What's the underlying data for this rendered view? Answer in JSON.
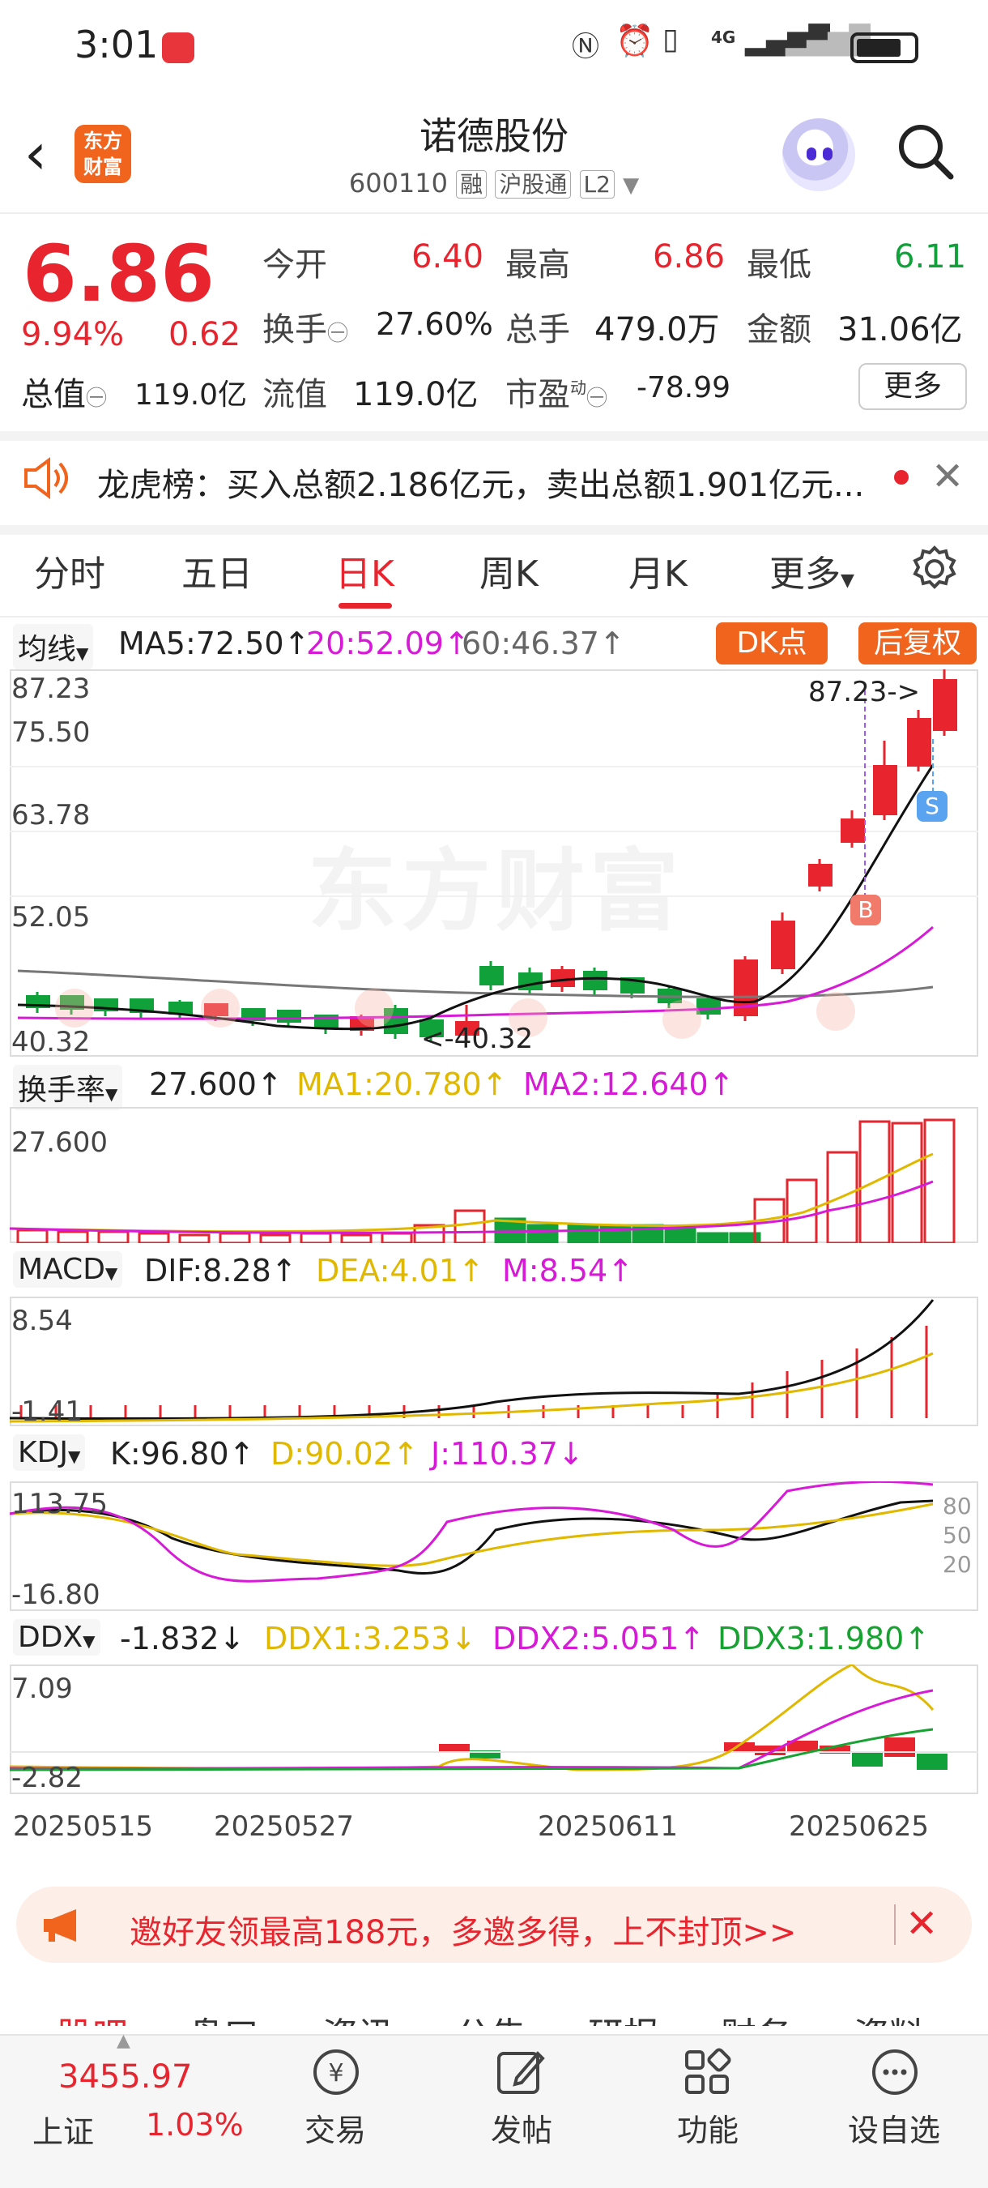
{
  "status_bar": {
    "time": "3:01",
    "network": "4G"
  },
  "header": {
    "logo_text": "东方财富",
    "stock_name": "诺德股份",
    "stock_code": "600110",
    "tags": [
      "融",
      "沪股通",
      "L2"
    ]
  },
  "quote": {
    "price": "6.86",
    "change_pct": "9.94%",
    "change_amt": "0.62",
    "market_cap_label": "总值",
    "market_cap": "119.0亿",
    "open_label": "今开",
    "open": "6.40",
    "high_label": "最高",
    "high": "6.86",
    "low_label": "最低",
    "low": "6.11",
    "turnover_label": "换手",
    "turnover": "27.60%",
    "volume_label": "总手",
    "volume": "479.0万",
    "amount_label": "金额",
    "amount": "31.06亿",
    "float_label": "流值",
    "float_cap": "119.0亿",
    "pe_label": "市盈",
    "pe_sup": "动",
    "pe": "-78.99",
    "more_label": "更多"
  },
  "notice": {
    "text": "龙虎榜：买入总额2.186亿元，卖出总额1.901亿元..."
  },
  "tabs": [
    "分时",
    "五日",
    "日K",
    "周K",
    "月K",
    "更多"
  ],
  "active_tab": "日K",
  "kline": {
    "ma_selector": "均线",
    "ma5": "MA5:72.50↑",
    "ma20": "20:52.09↑",
    "ma60": "60:46.37↑",
    "dk_button": "DK点",
    "adjust_button": "后复权",
    "y_labels": [
      "87.23",
      "75.50",
      "63.78",
      "52.05",
      "40.32"
    ],
    "high_marker": "87.23->",
    "low_marker": "<-40.32",
    "watermark": "东方财富",
    "signal_b": "B",
    "signal_s": "S"
  },
  "turnover_panel": {
    "selector": "换手率",
    "value": "27.600↑",
    "ma1": "MA1:20.780↑",
    "ma2": "MA2:12.640↑",
    "y_top": "27.600"
  },
  "macd_panel": {
    "selector": "MACD",
    "dif": "DIF:8.28↑",
    "dea": "DEA:4.01↑",
    "m": "M:8.54↑",
    "y_top": "8.54",
    "y_bottom": "-1.41"
  },
  "kdj_panel": {
    "selector": "KDJ",
    "k": "K:96.80↑",
    "d": "D:90.02↑",
    "j": "J:110.37↓",
    "y_top": "113.75",
    "y_bottom": "-16.80",
    "levels": [
      "80",
      "50",
      "20"
    ]
  },
  "ddx_panel": {
    "selector": "DDX",
    "ddx": "-1.832↓",
    "ddx1": "DDX1:3.253↓",
    "ddx2": "DDX2:5.051↑",
    "ddx3": "DDX3:1.980↑",
    "y_top": "7.09",
    "y_bottom": "-2.82"
  },
  "dates": [
    "20250515",
    "20250527",
    "20250611",
    "20250625"
  ],
  "invite": {
    "text": "邀好友领最高188元，多邀多得，上不封顶>>"
  },
  "bottom_tabs": [
    "股吧",
    "盘口",
    "资讯",
    "公告",
    "研报",
    "财务",
    "资料"
  ],
  "bottom_bar": {
    "index_value": "3455.97",
    "index_name": "上证",
    "index_pct": "1.03%",
    "items": [
      "交易",
      "发帖",
      "功能",
      "设自选"
    ]
  },
  "colors": {
    "up": "#e8252e",
    "down": "#11a13a",
    "ma5": "#111111",
    "ma20": "#d61ad6",
    "ma60": "#666666",
    "accent": "#f0641e"
  }
}
